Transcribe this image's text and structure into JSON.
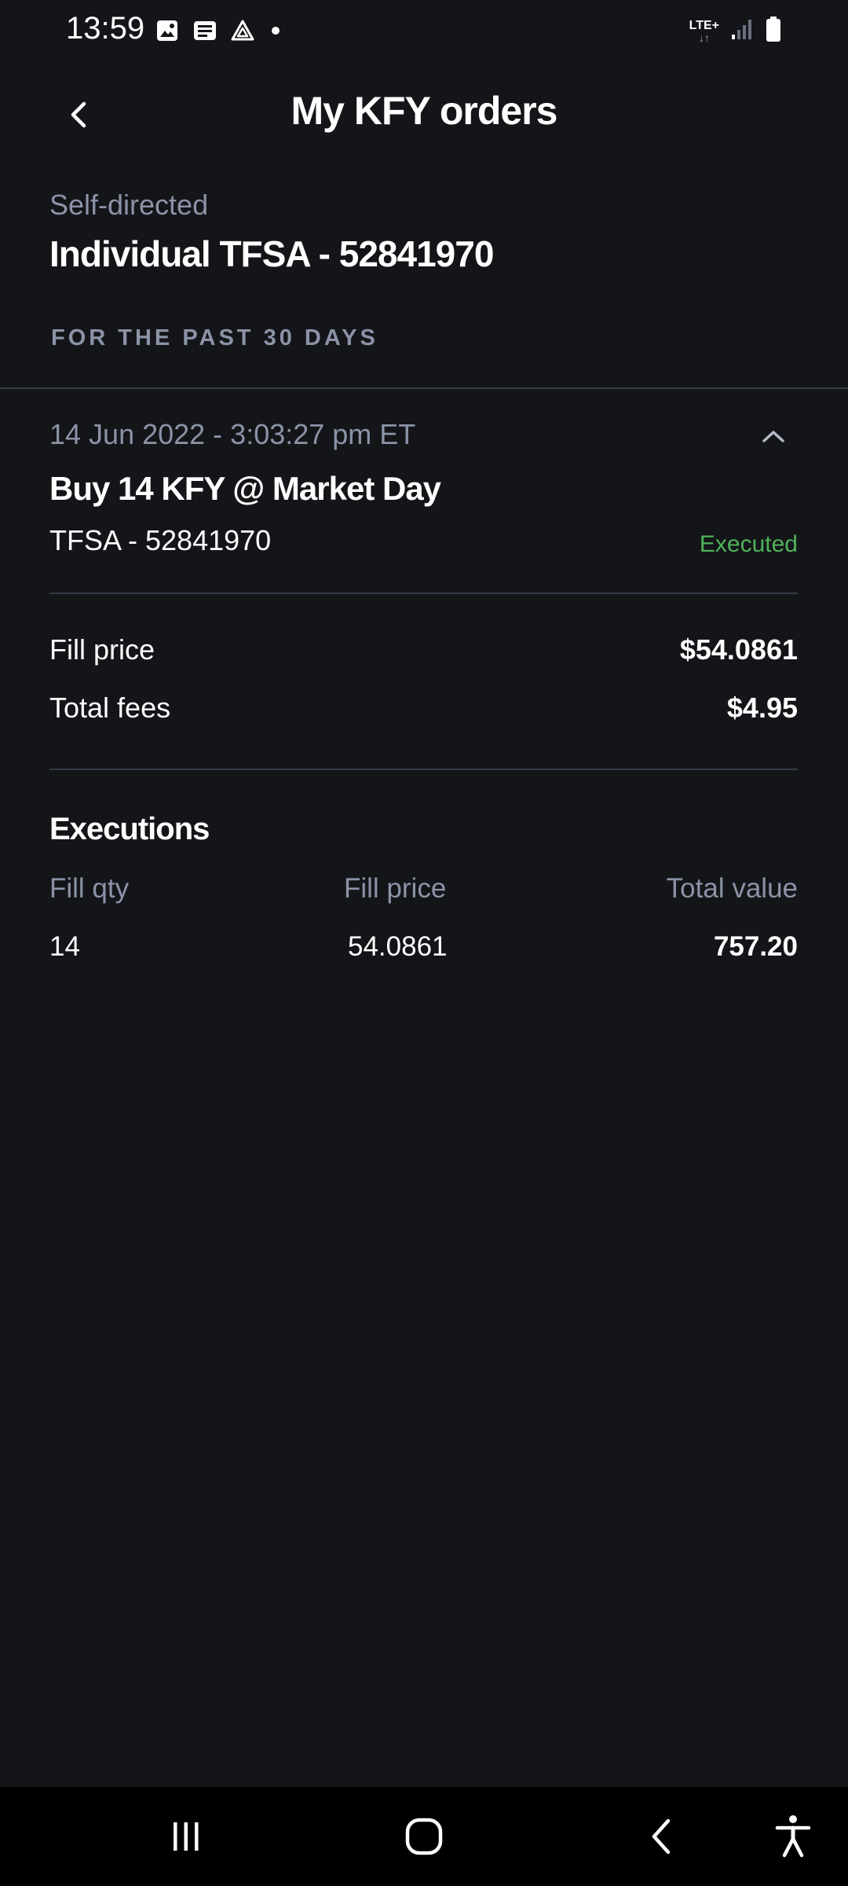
{
  "status_bar": {
    "time": "13:59",
    "network": "LTE+",
    "network_arrows": "↓↑",
    "icons_left": [
      "gallery-icon",
      "news-icon",
      "drive-icon",
      "notification-dot-icon"
    ],
    "icons_right": [
      "lte-icon",
      "signal-icon",
      "battery-icon"
    ]
  },
  "header": {
    "title": "My KFY orders",
    "back_icon": "chevron-left-icon"
  },
  "account": {
    "type": "Self-directed",
    "name": "Individual TFSA - 52841970",
    "period_label": "FOR THE PAST 30 DAYS"
  },
  "order": {
    "date": "14 Jun 2022 - 3:03:27 pm ET",
    "title": "Buy 14 KFY @ Market Day",
    "account": "TFSA - 52841970",
    "status": "Executed",
    "status_color": "#4fb35a",
    "expanded": true,
    "details": [
      {
        "label": "Fill price",
        "value": "$54.0861"
      },
      {
        "label": "Total fees",
        "value": "$4.95"
      }
    ]
  },
  "executions": {
    "title": "Executions",
    "columns": [
      "Fill qty",
      "Fill price",
      "Total value"
    ],
    "rows": [
      [
        "14",
        "54.0861",
        "757.20"
      ]
    ]
  },
  "nav_bar": {
    "buttons": [
      "recent-apps-icon",
      "home-icon",
      "back-icon",
      "accessibility-icon"
    ]
  },
  "colors": {
    "background": "#141519",
    "muted_text": "#8b93a7",
    "divider": "#3a3f4a",
    "nav_background": "#000000"
  }
}
